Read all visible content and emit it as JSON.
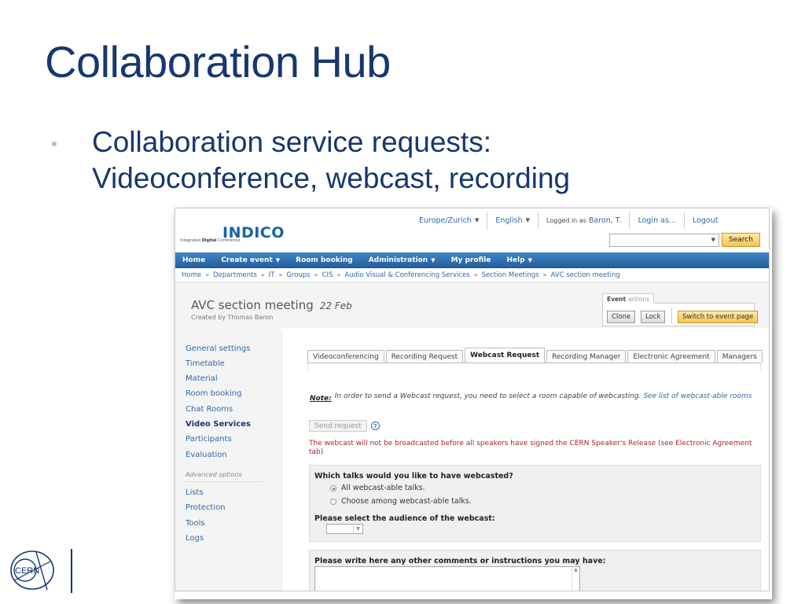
{
  "slide": {
    "title": "Collaboration Hub",
    "bullet_line1": "Collaboration service requests:",
    "bullet_line2": "Videoconference, webcast, recording"
  },
  "logo_text": "CERN",
  "indico": {
    "brand": "INDICO",
    "tagline_prefix": "Integrated",
    "tagline_bold": "Digital",
    "tagline_suffix": "Conference",
    "timezone": "Europe/Zurich",
    "language": "English",
    "logged_in_label": "Logged in as",
    "user_name": "Baron, T.",
    "login_as": "Login as...",
    "logout": "Logout",
    "search_placeholder": "",
    "search_button": "Search"
  },
  "nav": {
    "items": [
      "Home",
      "Create event",
      "Room booking",
      "Administration",
      "My profile",
      "Help"
    ]
  },
  "breadcrumb": [
    "Home",
    "Departments",
    "IT",
    "Groups",
    "CIS",
    "Audio Visual & Conferencing Services",
    "Section Meetings",
    "AVC section meeting"
  ],
  "event": {
    "title": "AVC section meeting",
    "date": "22 Feb",
    "creator": "Created by Thomas Baron",
    "actions_label": "Event",
    "actions_suffix": "actions",
    "clone": "Clone",
    "lock": "Lock",
    "switch": "Switch to event page"
  },
  "sidebar": {
    "items": [
      "General settings",
      "Timetable",
      "Material",
      "Room booking",
      "Chat Rooms",
      "Video Services",
      "Participants",
      "Evaluation"
    ],
    "advanced_label": "Advanced options",
    "advanced_items": [
      "Lists",
      "Protection",
      "Tools",
      "Logs"
    ]
  },
  "tabs": [
    "Videoconferencing",
    "Recording Request",
    "Webcast Request",
    "Recording Manager",
    "Electronic Agreement",
    "Managers"
  ],
  "content": {
    "note_label": "Note:",
    "note_text": "In order to send a Webcast request, you need to select a room capable of webcasting.",
    "note_link": "See list of webcast-able rooms",
    "send_button": "Send request",
    "help_glyph": "?",
    "warning": "The webcast will not be broadcasted before all speakers have signed the CERN Speaker's Release (see Electronic Agreement tab)",
    "q_talks": "Which talks would you like to have webcasted?",
    "opt_all": "All webcast-able talks.",
    "opt_choose": "Choose among webcast-able talks.",
    "q_audience": "Please select the audience of the webcast:",
    "audience_value": "",
    "q_comments": "Please write here any other comments or instructions you may have:"
  },
  "colors": {
    "title_blue": "#17376e",
    "nav_blue": "#2f6ab0",
    "link_blue": "#2f6aa8",
    "warning_red": "#a3262b",
    "button_gold": "#f5c456"
  }
}
